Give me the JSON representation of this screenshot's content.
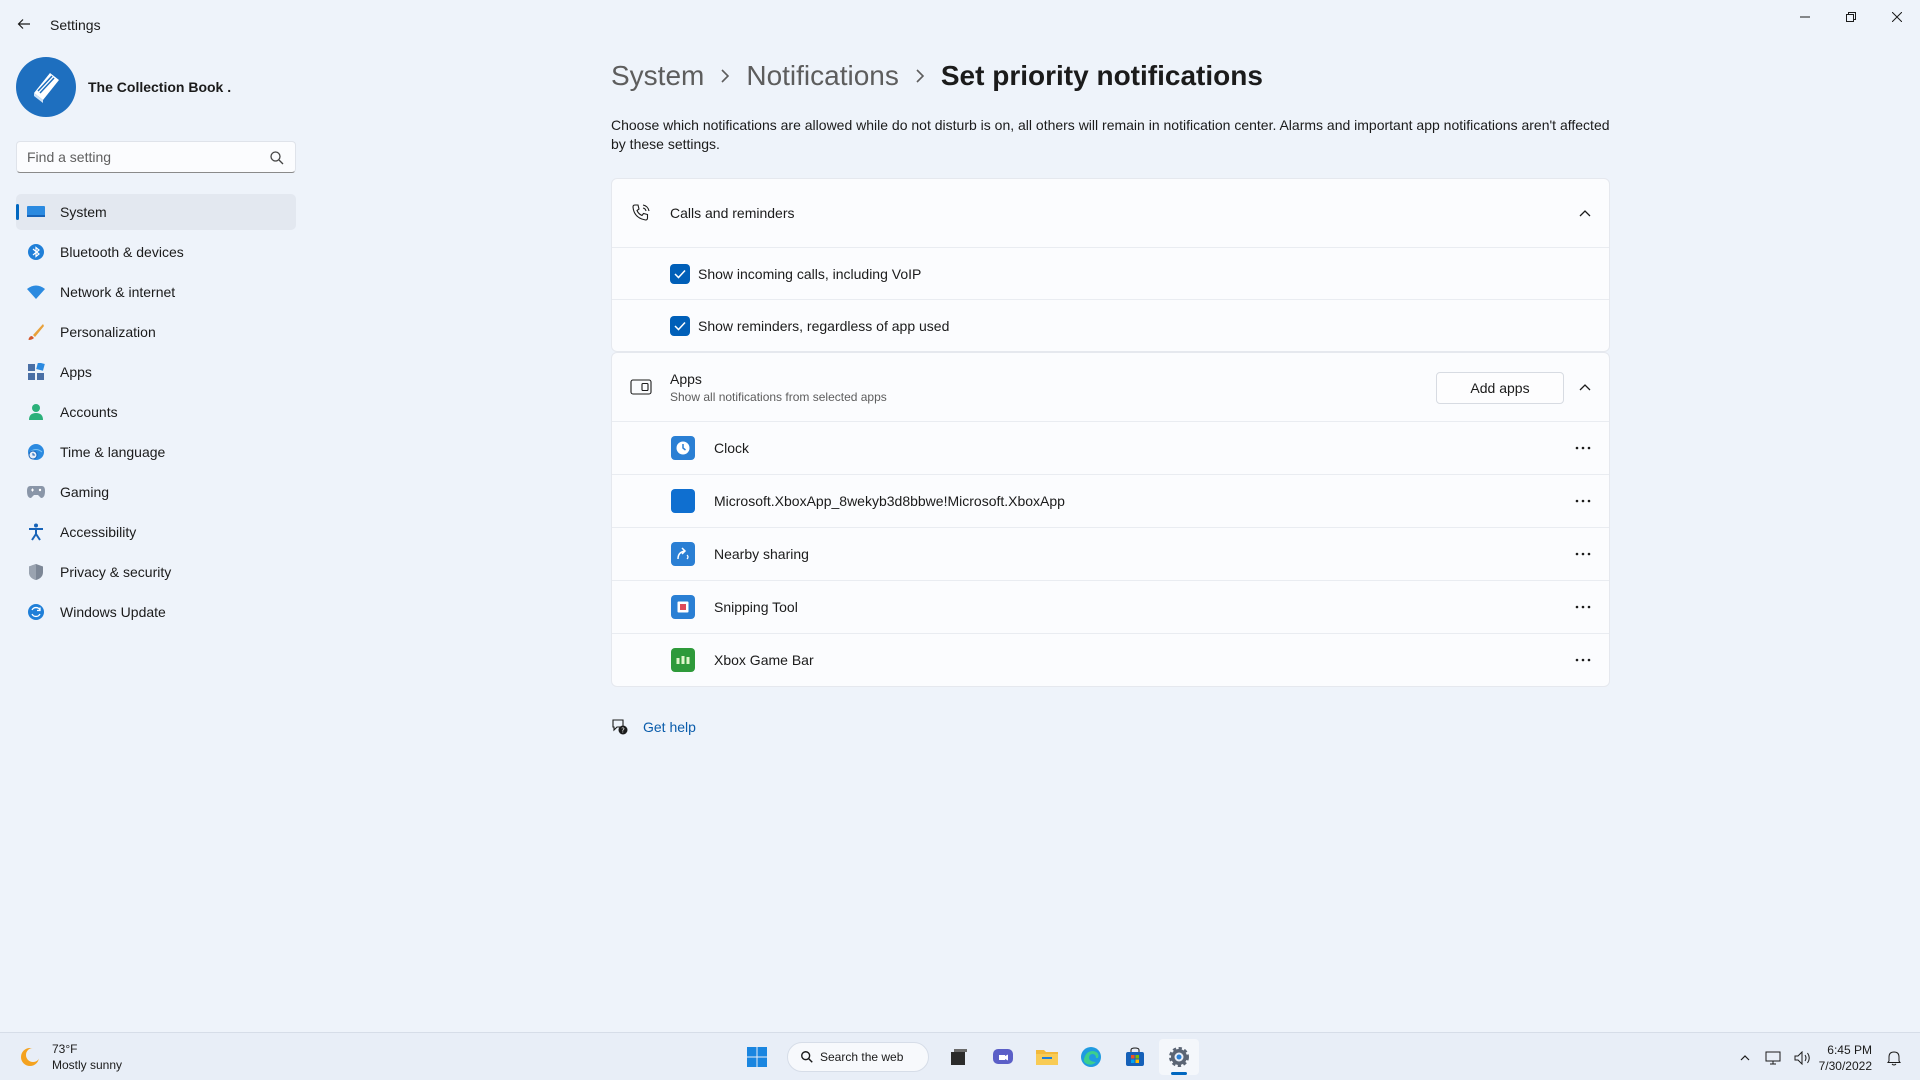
{
  "window": {
    "title": "Settings",
    "minimize_icon": "minimize-icon",
    "maximize_icon": "restore-icon",
    "close_icon": "close-icon"
  },
  "profile": {
    "name": "The Collection Book ."
  },
  "search": {
    "placeholder": "Find a setting",
    "value": ""
  },
  "sidebar": {
    "items": [
      {
        "label": "System",
        "icon": "monitor-icon",
        "active": true
      },
      {
        "label": "Bluetooth & devices",
        "icon": "bluetooth-icon"
      },
      {
        "label": "Network & internet",
        "icon": "wifi-icon"
      },
      {
        "label": "Personalization",
        "icon": "brush-icon"
      },
      {
        "label": "Apps",
        "icon": "apps-icon"
      },
      {
        "label": "Accounts",
        "icon": "person-icon"
      },
      {
        "label": "Time & language",
        "icon": "globe-clock-icon"
      },
      {
        "label": "Gaming",
        "icon": "gamepad-icon"
      },
      {
        "label": "Accessibility",
        "icon": "accessibility-icon"
      },
      {
        "label": "Privacy & security",
        "icon": "shield-icon"
      },
      {
        "label": "Windows Update",
        "icon": "update-icon"
      }
    ]
  },
  "breadcrumb": {
    "items": [
      "System",
      "Notifications"
    ],
    "current": "Set priority notifications"
  },
  "description": "Choose which notifications are allowed while do not disturb is on, all others will remain in notification center. Alarms and important app notifications aren't affected by these settings.",
  "calls_card": {
    "title": "Calls and reminders",
    "options": [
      {
        "label": "Show incoming calls, including VoIP",
        "checked": true
      },
      {
        "label": "Show reminders, regardless of app used",
        "checked": true
      }
    ]
  },
  "apps_card": {
    "title": "Apps",
    "subtitle": "Show all notifications from selected apps",
    "add_button": "Add apps",
    "apps": [
      {
        "name": "Clock",
        "icon": "clock-icon",
        "color": "#2a7fd4"
      },
      {
        "name": "Microsoft.XboxApp_8wekyb3d8bbwe!Microsoft.XboxApp",
        "icon": "xbox-app-icon",
        "color": "#0f6fd0"
      },
      {
        "name": "Nearby sharing",
        "icon": "nearby-sharing-icon",
        "color": "#2a7fd4"
      },
      {
        "name": "Snipping Tool",
        "icon": "snipping-tool-icon",
        "color": "#2a7fd4"
      },
      {
        "name": "Xbox Game Bar",
        "icon": "xbox-game-bar-icon",
        "color": "#2e9a3a"
      }
    ]
  },
  "help": {
    "label": "Get help"
  },
  "taskbar": {
    "weather_temp": "73°F",
    "weather_desc": "Mostly sunny",
    "search_label": "Search the web",
    "time": "6:45 PM",
    "date": "7/30/2022"
  },
  "colors": {
    "accent": "#0067c0",
    "background": "#eef3fa",
    "card": "#fbfcfe"
  }
}
